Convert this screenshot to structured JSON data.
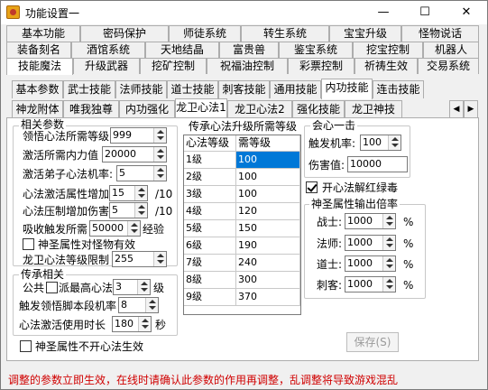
{
  "window": {
    "title": "功能设置一",
    "min": "—",
    "max": "☐",
    "close": "✕"
  },
  "tabs_row1": [
    "基本功能",
    "密码保护",
    "师徒系统",
    "转生系统",
    "宝宝升级",
    "怪物说话"
  ],
  "tabs_row2": [
    "装备刻名",
    "酒馆系统",
    "天地结晶",
    "富贵兽",
    "鉴宝系统",
    "挖宝控制",
    "机器人"
  ],
  "tabs_row3": [
    "技能魔法",
    "升级武器",
    "挖矿控制",
    "祝福油控制",
    "彩票控制",
    "祈祷生效",
    "交易系统"
  ],
  "subtabs": [
    "基本参数",
    "武士技能",
    "法师技能",
    "道士技能",
    "刺客技能",
    "通用技能",
    "内功技能",
    "连击技能"
  ],
  "subtabs2": [
    "神龙附体",
    "唯我独尊",
    "内功强化",
    "龙卫心法1",
    "龙卫心法2",
    "强化技能",
    "龙卫神技"
  ],
  "nav_arrows": [
    "◀",
    "▶"
  ],
  "params": {
    "title": "相关参数",
    "rows": [
      {
        "label": "领悟心法所需等级",
        "value": "999"
      },
      {
        "label": "激活所需内力值",
        "value": "20000"
      },
      {
        "label": "激活弟子心法机率:",
        "value": "5"
      },
      {
        "label": "心法激活属性增加",
        "value": "15",
        "suffix": "/10"
      },
      {
        "label": "心法压制增加伤害",
        "value": "5",
        "suffix": "/10"
      },
      {
        "label": "吸收触发所需",
        "value": "50000",
        "suffix": "经验"
      }
    ],
    "check_label": "神圣属性对怪物有效",
    "limit_label": "龙卫心法等级限制",
    "limit_value": "255"
  },
  "inherit": {
    "title": "传承相关",
    "row1_a": "公共",
    "row1_b": "派最高心法",
    "row1_value": "3",
    "row1_suffix": "级",
    "row2_label": "触发领悟脚本段机率",
    "row2_value": "8",
    "row3_label": "心法激活使用时长",
    "row3_value": "180",
    "row3_suffix": "秒"
  },
  "bottom_check": "神圣属性不开心法生效",
  "levels": {
    "title": "传承心法升级所需等级",
    "headers": [
      "心法等级",
      "需等级"
    ],
    "rows": [
      [
        "1级",
        "100"
      ],
      [
        "2级",
        "100"
      ],
      [
        "3级",
        "100"
      ],
      [
        "4级",
        "120"
      ],
      [
        "5级",
        "150"
      ],
      [
        "6级",
        "190"
      ],
      [
        "7级",
        "240"
      ],
      [
        "8级",
        "300"
      ],
      [
        "9级",
        "370"
      ]
    ]
  },
  "hit": {
    "title": "会心一击",
    "rate_label": "触发机率:",
    "rate_value": "100",
    "dmg_label": "伤害值:",
    "dmg_value": "10000"
  },
  "unlock_check": "开心法解红绿毒",
  "holy": {
    "title": "神圣属性输出倍率",
    "rows": [
      {
        "label": "战士:",
        "value": "1000",
        "suffix": "%"
      },
      {
        "label": "法师:",
        "value": "1000",
        "suffix": "%"
      },
      {
        "label": "道士:",
        "value": "1000",
        "suffix": "%"
      },
      {
        "label": "刺客:",
        "value": "1000",
        "suffix": "%"
      }
    ]
  },
  "save_label": "保存(S)",
  "status_text": "调整的参数立即生效，在线时请确认此参数的作用再调整，乱调整将导致游戏混乱"
}
